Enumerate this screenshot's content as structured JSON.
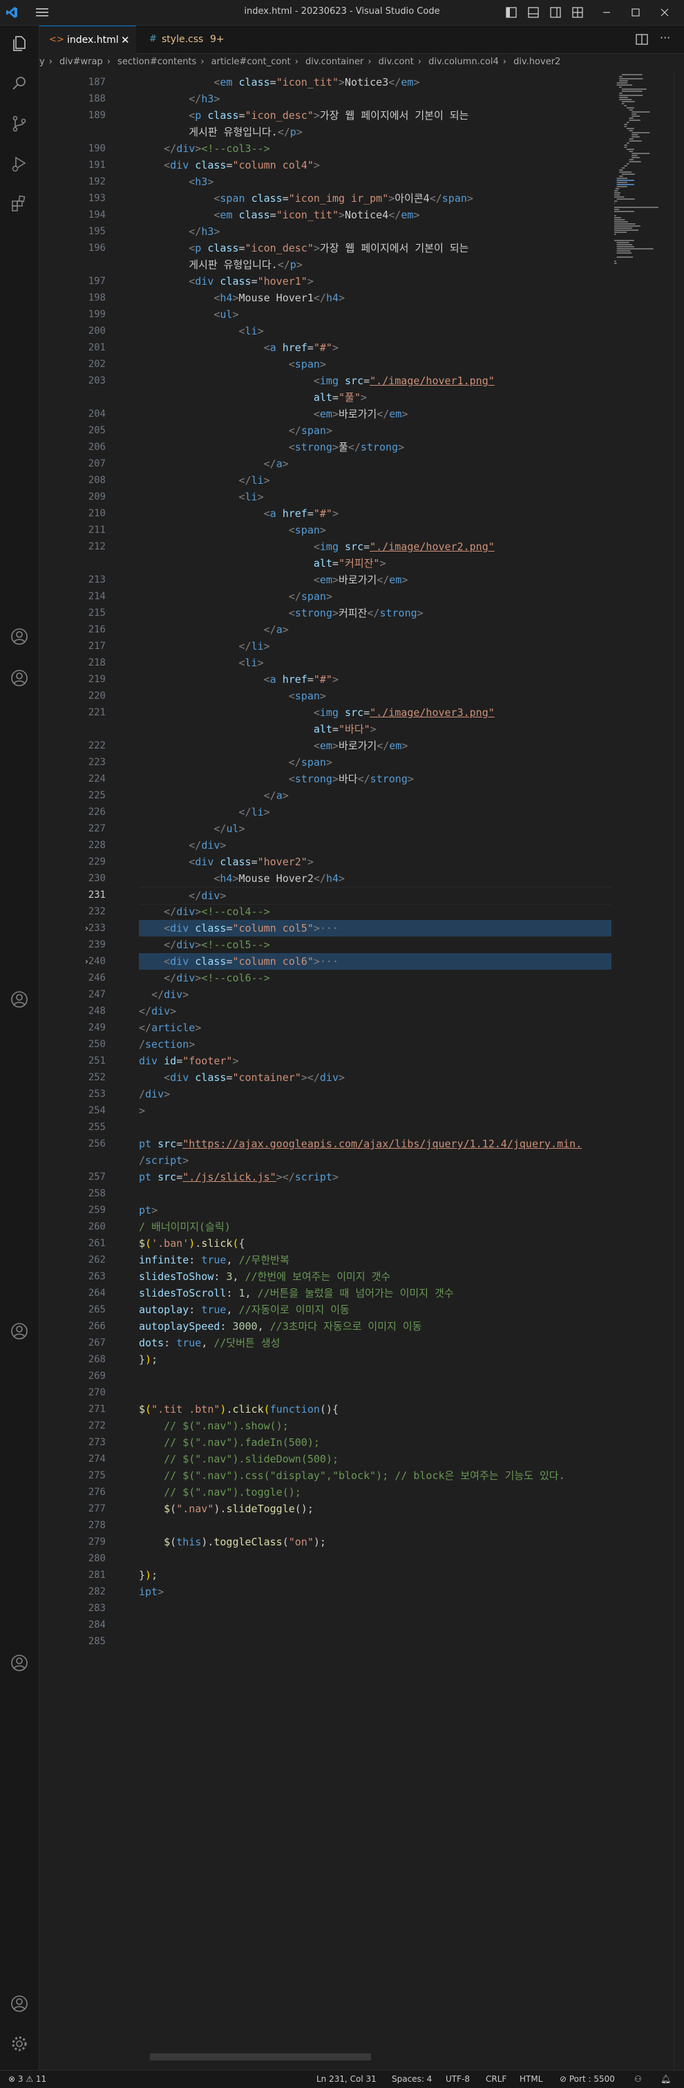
{
  "window": {
    "title": "index.html - 20230623 - Visual Studio Code"
  },
  "tabs": [
    {
      "label": "index.html",
      "active": true
    },
    {
      "label": "style.css",
      "badge": "9+"
    }
  ],
  "breadcrumb": [
    "y",
    "div#wrap",
    "section#contents",
    "article#cont_cont",
    "div.container",
    "div.cont",
    "div.column.col4",
    "div.hover2"
  ],
  "editor": {
    "lines": [
      {
        "n": "187",
        "html": "<span class='x'>            </span><span class='p'>&lt;</span><span class='t'>em</span> <span class='a'>class</span><span class='x'>=</span><span class='s'>\"icon_tit\"</span><span class='p'>&gt;</span><span class='x'>Notice3</span><span class='p'>&lt;/</span><span class='t'>em</span><span class='p'>&gt;</span>"
      },
      {
        "n": "188",
        "html": "<span class='x'>        </span><span class='p'>&lt;/</span><span class='t'>h3</span><span class='p'>&gt;</span>"
      },
      {
        "n": "189",
        "html": "<span class='x'>        </span><span class='p'>&lt;</span><span class='t'>p</span> <span class='a'>class</span><span class='x'>=</span><span class='s'>\"icon_desc\"</span><span class='p'>&gt;</span><span class='x'>가장 웹 페이지에서 기본이 되는</span>"
      },
      {
        "n": "",
        "html": "<span class='x'>        게시판 유형입니다.</span><span class='p'>&lt;/</span><span class='t'>p</span><span class='p'>&gt;</span>"
      },
      {
        "n": "190",
        "html": "<span class='x'>    </span><span class='p'>&lt;/</span><span class='t'>div</span><span class='p'>&gt;</span><span class='c'>&lt;!--col3--&gt;</span>"
      },
      {
        "n": "191",
        "html": "<span class='x'>    </span><span class='p'>&lt;</span><span class='t'>div</span> <span class='a'>class</span><span class='x'>=</span><span class='s'>\"column col4\"</span><span class='p'>&gt;</span>"
      },
      {
        "n": "192",
        "html": "<span class='x'>        </span><span class='p'>&lt;</span><span class='t'>h3</span><span class='p'>&gt;</span>"
      },
      {
        "n": "193",
        "html": "<span class='x'>            </span><span class='p'>&lt;</span><span class='t'>span</span> <span class='a'>class</span><span class='x'>=</span><span class='s'>\"icon_img ir_pm\"</span><span class='p'>&gt;</span><span class='x'>아이콘4</span><span class='p'>&lt;/</span><span class='t'>span</span><span class='p'>&gt;</span>"
      },
      {
        "n": "194",
        "html": "<span class='x'>            </span><span class='p'>&lt;</span><span class='t'>em</span> <span class='a'>class</span><span class='x'>=</span><span class='s'>\"icon_tit\"</span><span class='p'>&gt;</span><span class='x'>Notice4</span><span class='p'>&lt;/</span><span class='t'>em</span><span class='p'>&gt;</span>"
      },
      {
        "n": "195",
        "html": "<span class='x'>        </span><span class='p'>&lt;/</span><span class='t'>h3</span><span class='p'>&gt;</span>"
      },
      {
        "n": "196",
        "html": "<span class='x'>        </span><span class='p'>&lt;</span><span class='t'>p</span> <span class='a'>class</span><span class='x'>=</span><span class='s'>\"icon_desc\"</span><span class='p'>&gt;</span><span class='x'>가장 웹 페이지에서 기본이 되는</span>"
      },
      {
        "n": "",
        "html": "<span class='x'>        게시판 유형입니다.</span><span class='p'>&lt;/</span><span class='t'>p</span><span class='p'>&gt;</span>"
      },
      {
        "n": "197",
        "html": "<span class='x'>        </span><span class='p'>&lt;</span><span class='t'>div</span> <span class='a'>class</span><span class='x'>=</span><span class='s'>\"hover1\"</span><span class='p'>&gt;</span>"
      },
      {
        "n": "198",
        "html": "<span class='x'>            </span><span class='p'>&lt;</span><span class='t'>h4</span><span class='p'>&gt;</span><span class='x'>Mouse Hover1</span><span class='p'>&lt;/</span><span class='t'>h4</span><span class='p'>&gt;</span>"
      },
      {
        "n": "199",
        "html": "<span class='x'>            </span><span class='p'>&lt;</span><span class='t'>ul</span><span class='p'>&gt;</span>"
      },
      {
        "n": "200",
        "html": "<span class='x'>                </span><span class='p'>&lt;</span><span class='t'>li</span><span class='p'>&gt;</span>"
      },
      {
        "n": "201",
        "html": "<span class='x'>                    </span><span class='p'>&lt;</span><span class='t'>a</span> <span class='a'>href</span><span class='x'>=</span><span class='s'>\"#\"</span><span class='p'>&gt;</span>"
      },
      {
        "n": "202",
        "html": "<span class='x'>                        </span><span class='p'>&lt;</span><span class='t'>span</span><span class='p'>&gt;</span>"
      },
      {
        "n": "203",
        "html": "<span class='x'>                            </span><span class='p'>&lt;</span><span class='t'>img</span> <span class='a'>src</span><span class='x'>=</span><span class='s u'>\"./image/hover1.png\"</span>"
      },
      {
        "n": "",
        "html": "<span class='x'>                            </span><span class='a'>alt</span><span class='x'>=</span><span class='s'>\"풀\"</span><span class='p'>&gt;</span>"
      },
      {
        "n": "204",
        "html": "<span class='x'>                            </span><span class='p'>&lt;</span><span class='t'>em</span><span class='p'>&gt;</span><span class='x'>바로가기</span><span class='p'>&lt;/</span><span class='t'>em</span><span class='p'>&gt;</span>"
      },
      {
        "n": "205",
        "html": "<span class='x'>                        </span><span class='p'>&lt;/</span><span class='t'>span</span><span class='p'>&gt;</span>"
      },
      {
        "n": "206",
        "html": "<span class='x'>                        </span><span class='p'>&lt;</span><span class='t'>strong</span><span class='p'>&gt;</span><span class='x'>풀</span><span class='p'>&lt;/</span><span class='t'>strong</span><span class='p'>&gt;</span>"
      },
      {
        "n": "207",
        "html": "<span class='x'>                    </span><span class='p'>&lt;/</span><span class='t'>a</span><span class='p'>&gt;</span>"
      },
      {
        "n": "208",
        "html": "<span class='x'>                </span><span class='p'>&lt;/</span><span class='t'>li</span><span class='p'>&gt;</span>"
      },
      {
        "n": "209",
        "html": "<span class='x'>                </span><span class='p'>&lt;</span><span class='t'>li</span><span class='p'>&gt;</span>"
      },
      {
        "n": "210",
        "html": "<span class='x'>                    </span><span class='p'>&lt;</span><span class='t'>a</span> <span class='a'>href</span><span class='x'>=</span><span class='s'>\"#\"</span><span class='p'>&gt;</span>"
      },
      {
        "n": "211",
        "html": "<span class='x'>                        </span><span class='p'>&lt;</span><span class='t'>span</span><span class='p'>&gt;</span>"
      },
      {
        "n": "212",
        "html": "<span class='x'>                            </span><span class='p'>&lt;</span><span class='t'>img</span> <span class='a'>src</span><span class='x'>=</span><span class='s u'>\"./image/hover2.png\"</span>"
      },
      {
        "n": "",
        "html": "<span class='x'>                            </span><span class='a'>alt</span><span class='x'>=</span><span class='s'>\"커피잔\"</span><span class='p'>&gt;</span>"
      },
      {
        "n": "213",
        "html": "<span class='x'>                            </span><span class='p'>&lt;</span><span class='t'>em</span><span class='p'>&gt;</span><span class='x'>바로가기</span><span class='p'>&lt;/</span><span class='t'>em</span><span class='p'>&gt;</span>"
      },
      {
        "n": "214",
        "html": "<span class='x'>                        </span><span class='p'>&lt;/</span><span class='t'>span</span><span class='p'>&gt;</span>"
      },
      {
        "n": "215",
        "html": "<span class='x'>                        </span><span class='p'>&lt;</span><span class='t'>strong</span><span class='p'>&gt;</span><span class='x'>커피잔</span><span class='p'>&lt;/</span><span class='t'>strong</span><span class='p'>&gt;</span>"
      },
      {
        "n": "216",
        "html": "<span class='x'>                    </span><span class='p'>&lt;/</span><span class='t'>a</span><span class='p'>&gt;</span>"
      },
      {
        "n": "217",
        "html": "<span class='x'>                </span><span class='p'>&lt;/</span><span class='t'>li</span><span class='p'>&gt;</span>"
      },
      {
        "n": "218",
        "html": "<span class='x'>                </span><span class='p'>&lt;</span><span class='t'>li</span><span class='p'>&gt;</span>"
      },
      {
        "n": "219",
        "html": "<span class='x'>                    </span><span class='p'>&lt;</span><span class='t'>a</span> <span class='a'>href</span><span class='x'>=</span><span class='s'>\"#\"</span><span class='p'>&gt;</span>"
      },
      {
        "n": "220",
        "html": "<span class='x'>                        </span><span class='p'>&lt;</span><span class='t'>span</span><span class='p'>&gt;</span>"
      },
      {
        "n": "221",
        "html": "<span class='x'>                            </span><span class='p'>&lt;</span><span class='t'>img</span> <span class='a'>src</span><span class='x'>=</span><span class='s u'>\"./image/hover3.png\"</span>"
      },
      {
        "n": "",
        "html": "<span class='x'>                            </span><span class='a'>alt</span><span class='x'>=</span><span class='s'>\"바다\"</span><span class='p'>&gt;</span>"
      },
      {
        "n": "222",
        "html": "<span class='x'>                            </span><span class='p'>&lt;</span><span class='t'>em</span><span class='p'>&gt;</span><span class='x'>바로가기</span><span class='p'>&lt;/</span><span class='t'>em</span><span class='p'>&gt;</span>"
      },
      {
        "n": "223",
        "html": "<span class='x'>                        </span><span class='p'>&lt;/</span><span class='t'>span</span><span class='p'>&gt;</span>"
      },
      {
        "n": "224",
        "html": "<span class='x'>                        </span><span class='p'>&lt;</span><span class='t'>strong</span><span class='p'>&gt;</span><span class='x'>바다</span><span class='p'>&lt;/</span><span class='t'>strong</span><span class='p'>&gt;</span>"
      },
      {
        "n": "225",
        "html": "<span class='x'>                    </span><span class='p'>&lt;/</span><span class='t'>a</span><span class='p'>&gt;</span>"
      },
      {
        "n": "226",
        "html": "<span class='x'>                </span><span class='p'>&lt;/</span><span class='t'>li</span><span class='p'>&gt;</span>"
      },
      {
        "n": "227",
        "html": "<span class='x'>            </span><span class='p'>&lt;/</span><span class='t'>ul</span><span class='p'>&gt;</span>"
      },
      {
        "n": "228",
        "html": "<span class='x'>        </span><span class='p'>&lt;/</span><span class='t'>div</span><span class='p'>&gt;</span>"
      },
      {
        "n": "229",
        "html": "<span class='x'>        </span><span class='p'>&lt;</span><span class='t'>div</span> <span class='a'>class</span><span class='x'>=</span><span class='s'>\"hover2\"</span><span class='p'>&gt;</span>"
      },
      {
        "n": "230",
        "html": "<span class='x'>            </span><span class='p'>&lt;</span><span class='t'>h4</span><span class='p'>&gt;</span><span class='x'>Mouse Hover2</span><span class='p'>&lt;/</span><span class='t'>h4</span><span class='p'>&gt;</span>"
      },
      {
        "n": "231",
        "cur": true,
        "html": "<span class='x'>        </span><span class='p'>&lt;/</span><span class='t'>div</span><span class='p'>&gt;</span>"
      },
      {
        "n": "232",
        "html": "<span class='x'>    </span><span class='p'>&lt;/</span><span class='t'>div</span><span class='p'>&gt;</span><span class='c'>&lt;!--col4--&gt;</span>"
      },
      {
        "n": "233",
        "fold": true,
        "hl": true,
        "html": "<span class='x'>    </span><span class='p'>&lt;</span><span class='t'>div</span> <span class='a'>class</span><span class='x'>=</span><span class='s'>\"column col5\"</span><span class='p'>&gt;</span><span class='p'>···</span>"
      },
      {
        "n": "239",
        "html": "<span class='x'>    </span><span class='p'>&lt;/</span><span class='t'>div</span><span class='p'>&gt;</span><span class='c'>&lt;!--col5--&gt;</span>"
      },
      {
        "n": "240",
        "fold": true,
        "hl": true,
        "html": "<span class='x'>    </span><span class='p'>&lt;</span><span class='t'>div</span> <span class='a'>class</span><span class='x'>=</span><span class='s'>\"column col6\"</span><span class='p'>&gt;</span><span class='p'>···</span>"
      },
      {
        "n": "246",
        "html": "<span class='x'>    </span><span class='p'>&lt;/</span><span class='t'>div</span><span class='p'>&gt;</span><span class='c'>&lt;!--col6--&gt;</span>"
      },
      {
        "n": "247",
        "html": "<span class='x'>  </span><span class='p'>&lt;/</span><span class='t'>div</span><span class='p'>&gt;</span>"
      },
      {
        "n": "248",
        "html": "<span class='p'>&lt;/</span><span class='t'>div</span><span class='p'>&gt;</span>"
      },
      {
        "n": "249",
        "html": "<span class='p'>&lt;/</span><span class='t'>article</span><span class='p'>&gt;</span>"
      },
      {
        "n": "250",
        "html": "<span class='p'>/</span><span class='t'>section</span><span class='p'>&gt;</span>"
      },
      {
        "n": "251",
        "html": "<span class='t'>div</span> <span class='a'>id</span><span class='x'>=</span><span class='s'>\"footer\"</span><span class='p'>&gt;</span>"
      },
      {
        "n": "252",
        "html": "<span class='x'>    </span><span class='p'>&lt;</span><span class='t'>div</span> <span class='a'>class</span><span class='x'>=</span><span class='s'>\"container\"</span><span class='p'>&gt;&lt;/</span><span class='t'>div</span><span class='p'>&gt;</span>"
      },
      {
        "n": "253",
        "html": "<span class='p'>/</span><span class='t'>div</span><span class='p'>&gt;</span>"
      },
      {
        "n": "254",
        "html": "<span class='p'>&gt;</span>"
      },
      {
        "n": "255",
        "html": ""
      },
      {
        "n": "256",
        "html": "<span class='t'>pt</span> <span class='a'>src</span><span class='x'>=</span><span class='s u'>\"https://ajax.googleapis.com/ajax/libs/jquery/1.12.4/jquery.min.</span>"
      },
      {
        "n": "",
        "html": "<span class='p'>/</span><span class='t'>script</span><span class='p'>&gt;</span>"
      },
      {
        "n": "257",
        "html": "<span class='t'>pt</span> <span class='a'>src</span><span class='x'>=</span><span class='s u'>\"./js/slick.js\"</span><span class='p'>&gt;&lt;/</span><span class='t'>script</span><span class='p'>&gt;</span>"
      },
      {
        "n": "258",
        "html": ""
      },
      {
        "n": "259",
        "html": "<span class='t'>pt</span><span class='p'>&gt;</span>"
      },
      {
        "n": "260",
        "html": "<span class='c'>/ 배너이미지(슬릭)</span>"
      },
      {
        "n": "261",
        "html": "<span class='f'>$</span><span class='y'>(</span><span class='s'>'.ban'</span><span class='y'>)</span><span class='x'>.</span><span class='f'>slick</span><span class='y'>(</span><span class='x'>{</span>"
      },
      {
        "n": "262",
        "html": "<span class='a'>infinite</span><span class='x'>: </span><span class='k'>true</span><span class='x'>, </span><span class='c'>//무한반복</span>"
      },
      {
        "n": "263",
        "html": "<span class='a'>slidesToShow</span><span class='x'>: </span><span class='n'>3</span><span class='x'>, </span><span class='c'>//한번에 보여주는 이미지 갯수</span>"
      },
      {
        "n": "264",
        "html": "<span class='a'>slidesToScroll</span><span class='x'>: </span><span class='n'>1</span><span class='x'>, </span><span class='c'>//버튼을 눌렀을 때 넘어가는 이미지 갯수</span>"
      },
      {
        "n": "265",
        "html": "<span class='a'>autoplay</span><span class='x'>: </span><span class='k'>true</span><span class='x'>, </span><span class='c'>//자동이로 이미지 이동</span>"
      },
      {
        "n": "266",
        "html": "<span class='a'>autoplaySpeed</span><span class='x'>: </span><span class='n'>3000</span><span class='x'>, </span><span class='c'>//3초마다 자동으로 이미지 이동</span>"
      },
      {
        "n": "267",
        "html": "<span class='a'>dots</span><span class='x'>: </span><span class='k'>true</span><span class='x'>, </span><span class='c'>//닷버튼 생성</span>"
      },
      {
        "n": "268",
        "html": "<span class='x'>}</span><span class='y'>)</span><span class='x'>;</span>"
      },
      {
        "n": "269",
        "html": ""
      },
      {
        "n": "270",
        "html": ""
      },
      {
        "n": "271",
        "html": "<span class='f'>$</span><span class='y'>(</span><span class='s'>\".tit .btn\"</span><span class='y'>)</span><span class='x'>.</span><span class='f'>click</span><span class='y'>(</span><span class='k'>function</span><span class='x'>(){</span>"
      },
      {
        "n": "272",
        "html": "<span class='c'>    // $(\".nav\").show();</span>"
      },
      {
        "n": "273",
        "html": "<span class='c'>    // $(\".nav\").fadeIn(500);</span>"
      },
      {
        "n": "274",
        "html": "<span class='c'>    // $(\".nav\").slideDown(500);</span>"
      },
      {
        "n": "275",
        "html": "<span class='c'>    // $(\".nav\").css(\"display\",\"block\"); // block은 보여주는 기능도 있다.</span>"
      },
      {
        "n": "276",
        "html": "<span class='c'>    // $(\".nav\").toggle();</span>"
      },
      {
        "n": "277",
        "html": "<span class='x'>    </span><span class='f'>$</span><span class='x'>(</span><span class='s'>\".nav\"</span><span class='x'>).</span><span class='f'>slideToggle</span><span class='x'>();</span>"
      },
      {
        "n": "278",
        "html": ""
      },
      {
        "n": "279",
        "html": "<span class='x'>    </span><span class='f'>$</span><span class='x'>(</span><span class='k'>this</span><span class='x'>).</span><span class='f'>toggleClass</span><span class='x'>(</span><span class='s'>\"on\"</span><span class='x'>);</span>"
      },
      {
        "n": "280",
        "html": ""
      },
      {
        "n": "281",
        "html": "<span class='x'>}</span><span class='y'>)</span><span class='x'>;</span>"
      },
      {
        "n": "282",
        "html": "<span class='t'>ipt</span><span class='p'>&gt;</span>"
      },
      {
        "n": "283",
        "html": ""
      },
      {
        "n": "284",
        "html": ""
      },
      {
        "n": "285",
        "html": ""
      }
    ]
  },
  "statusbar": {
    "problems": "⊗ 3 ⚠ 11",
    "position": "Ln 231, Col 31",
    "spaces": "Spaces: 4",
    "encoding": "UTF-8",
    "eol": "CRLF",
    "language": "HTML",
    "port": "⊘ Port : 5500"
  },
  "colors": {
    "accent": "#0078d4",
    "tag": "#569cd6",
    "attribute": "#9cdcfe",
    "string": "#ce9178",
    "comment": "#6a9955"
  }
}
